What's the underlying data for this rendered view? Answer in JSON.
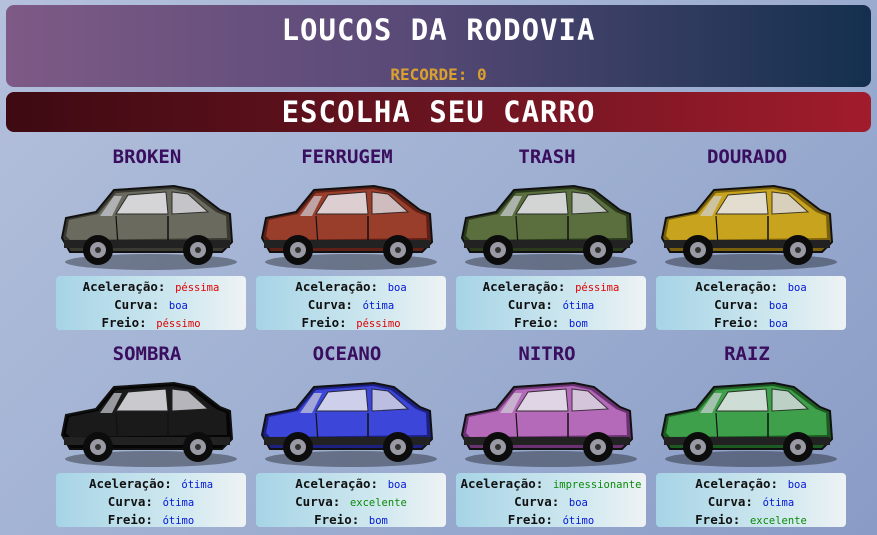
{
  "header": {
    "title": "LOUCOS DA RODOVIA",
    "record_label": "RECORDE: 0"
  },
  "selector": {
    "title": "ESCOLHA SEU CARRO"
  },
  "stat_labels": {
    "accel": "Aceleração:",
    "curve": "Curva:",
    "brake": "Freio:"
  },
  "cars": [
    {
      "name": "BROKEN",
      "body": "#6a6a5e",
      "shade": "#3a3a32",
      "accel": "péssima",
      "curve": "boa",
      "brake": "péssimo",
      "ac": "#e00000",
      "cc": "#0018d8",
      "bc": "#e00000"
    },
    {
      "name": "FERRUGEM",
      "body": "#9a3e2c",
      "shade": "#5e2016",
      "accel": "boa",
      "curve": "ótima",
      "brake": "péssimo",
      "ac": "#0018d8",
      "cc": "#0018d8",
      "bc": "#e00000"
    },
    {
      "name": "TRASH",
      "body": "#5a6e3e",
      "shade": "#2c3a1c",
      "accel": "péssima",
      "curve": "ótima",
      "brake": "bom",
      "ac": "#e00000",
      "cc": "#0018d8",
      "bc": "#0018d8"
    },
    {
      "name": "DOURADO",
      "body": "#c8a41e",
      "shade": "#7a600c",
      "accel": "boa",
      "curve": "boa",
      "brake": "boa",
      "ac": "#0018d8",
      "cc": "#0018d8",
      "bc": "#0018d8"
    },
    {
      "name": "SOMBRA",
      "body": "#1a1a1a",
      "shade": "#050505",
      "accel": "ótima",
      "curve": "ótima",
      "brake": "ótimo",
      "ac": "#0018d8",
      "cc": "#0018d8",
      "bc": "#0018d8"
    },
    {
      "name": "OCEANO",
      "body": "#3c46d8",
      "shade": "#1c2080",
      "accel": "boa",
      "curve": "excelente",
      "brake": "bom",
      "ac": "#0018d8",
      "cc": "#0a8a0a",
      "bc": "#0018d8"
    },
    {
      "name": "NITRO",
      "body": "#b46ab8",
      "shade": "#6a3270",
      "accel": "impressionante",
      "curve": "boa",
      "brake": "ótimo",
      "ac": "#0a8a0a",
      "cc": "#0018d8",
      "bc": "#0018d8"
    },
    {
      "name": "RAIZ",
      "body": "#3ea04a",
      "shade": "#1c5a22",
      "accel": "boa",
      "curve": "ótima",
      "brake": "excelente",
      "ac": "#0018d8",
      "cc": "#0018d8",
      "bc": "#0a8a0a"
    }
  ]
}
